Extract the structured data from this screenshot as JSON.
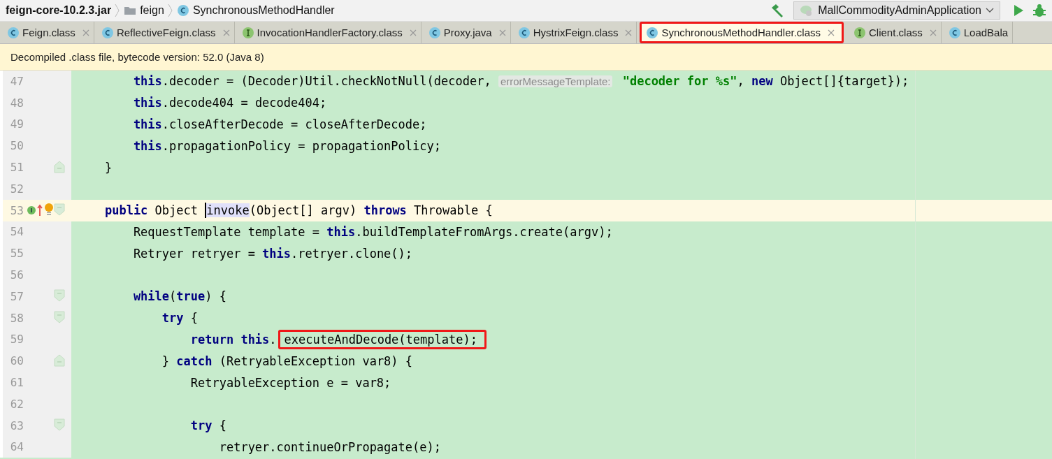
{
  "breadcrumb": [
    {
      "label": "feign-core-10.2.3.jar",
      "kind": "jar"
    },
    {
      "label": "feign",
      "kind": "folder"
    },
    {
      "label": "SynchronousMethodHandler",
      "kind": "class"
    }
  ],
  "run_config": {
    "label": "MallCommodityAdminApplication"
  },
  "tabs": [
    {
      "label": "Feign.class",
      "kind": "class",
      "selected": false,
      "closable": true,
      "marked": false
    },
    {
      "label": "ReflectiveFeign.class",
      "kind": "class",
      "selected": false,
      "closable": true,
      "marked": false
    },
    {
      "label": "InvocationHandlerFactory.class",
      "kind": "interface",
      "selected": false,
      "closable": true,
      "marked": false
    },
    {
      "label": "Proxy.java",
      "kind": "class",
      "selected": false,
      "closable": true,
      "marked": false
    },
    {
      "label": "HystrixFeign.class",
      "kind": "class",
      "selected": false,
      "closable": true,
      "marked": false
    },
    {
      "label": "SynchronousMethodHandler.class",
      "kind": "class",
      "selected": true,
      "closable": true,
      "marked": true
    },
    {
      "label": "Client.class",
      "kind": "interface",
      "selected": false,
      "closable": true,
      "marked": false
    },
    {
      "label": "LoadBala",
      "kind": "class",
      "selected": false,
      "closable": false,
      "marked": false
    }
  ],
  "banner": {
    "text": "Decompiled .class file, bytecode version: 52.0 (Java 8)"
  },
  "code_lines": [
    {
      "number": "47",
      "current": false,
      "fold_start": false,
      "fold_end": false,
      "gutter_icons": false,
      "segments": [
        {
          "kind": "kw",
          "text": "        this"
        },
        {
          "kind": "plain",
          "text": ".decoder = (Decoder)Util.checkNotNull(decoder, "
        },
        {
          "kind": "hint",
          "text": "errorMessageTemplate:"
        },
        {
          "kind": "str",
          "text": " \"decoder for %s\""
        },
        {
          "kind": "plain",
          "text": ", "
        },
        {
          "kind": "kw",
          "text": "new"
        },
        {
          "kind": "plain",
          "text": " Object[]{target});"
        }
      ]
    },
    {
      "number": "48",
      "current": false,
      "fold_start": false,
      "fold_end": false,
      "gutter_icons": false,
      "segments": [
        {
          "kind": "kw",
          "text": "        this"
        },
        {
          "kind": "plain",
          "text": ".decode404 = decode404;"
        }
      ]
    },
    {
      "number": "49",
      "current": false,
      "fold_start": false,
      "fold_end": false,
      "gutter_icons": false,
      "segments": [
        {
          "kind": "kw",
          "text": "        this"
        },
        {
          "kind": "plain",
          "text": ".closeAfterDecode = closeAfterDecode;"
        }
      ]
    },
    {
      "number": "50",
      "current": false,
      "fold_start": false,
      "fold_end": false,
      "gutter_icons": false,
      "segments": [
        {
          "kind": "kw",
          "text": "        this"
        },
        {
          "kind": "plain",
          "text": ".propagationPolicy = propagationPolicy;"
        }
      ]
    },
    {
      "number": "51",
      "current": false,
      "fold_start": false,
      "fold_end": true,
      "gutter_icons": false,
      "segments": [
        {
          "kind": "plain",
          "text": "    }"
        }
      ]
    },
    {
      "number": "52",
      "current": false,
      "fold_start": false,
      "fold_end": false,
      "gutter_icons": false
    },
    {
      "number": "53",
      "current": true,
      "fold_start": true,
      "fold_end": false,
      "gutter_icons": true,
      "segments": [
        {
          "kind": "kw",
          "text": "    public"
        },
        {
          "kind": "plain",
          "text": " Object "
        },
        {
          "kind": "ident",
          "text": "invoke"
        },
        {
          "kind": "plain",
          "text": "(Object[] argv) "
        },
        {
          "kind": "kw",
          "text": "throws"
        },
        {
          "kind": "plain",
          "text": " Throwable {"
        }
      ]
    },
    {
      "number": "54",
      "current": false,
      "fold_start": false,
      "fold_end": false,
      "gutter_icons": false,
      "segments": [
        {
          "kind": "plain",
          "text": "        RequestTemplate template = "
        },
        {
          "kind": "kw",
          "text": "this"
        },
        {
          "kind": "plain",
          "text": ".buildTemplateFromArgs.create(argv);"
        }
      ]
    },
    {
      "number": "55",
      "current": false,
      "fold_start": false,
      "fold_end": false,
      "gutter_icons": false,
      "segments": [
        {
          "kind": "plain",
          "text": "        Retryer retryer = "
        },
        {
          "kind": "kw",
          "text": "this"
        },
        {
          "kind": "plain",
          "text": ".retryer.clone();"
        }
      ]
    },
    {
      "number": "56",
      "current": false,
      "fold_start": false,
      "fold_end": false,
      "gutter_icons": false
    },
    {
      "number": "57",
      "current": false,
      "fold_start": true,
      "fold_end": false,
      "gutter_icons": false,
      "segments": [
        {
          "kind": "kw",
          "text": "        while"
        },
        {
          "kind": "plain",
          "text": "("
        },
        {
          "kind": "kw",
          "text": "true"
        },
        {
          "kind": "plain",
          "text": ") {"
        }
      ]
    },
    {
      "number": "58",
      "current": false,
      "fold_start": true,
      "fold_end": false,
      "gutter_icons": false,
      "segments": [
        {
          "kind": "kw",
          "text": "            try"
        },
        {
          "kind": "plain",
          "text": " {"
        }
      ]
    },
    {
      "number": "59",
      "current": false,
      "fold_start": false,
      "fold_end": false,
      "gutter_icons": false,
      "segments": [
        {
          "kind": "kw",
          "text": "                return this"
        },
        {
          "kind": "plain",
          "text": "."
        },
        {
          "kind": "marked",
          "text": "executeAndDecode(template);"
        }
      ]
    },
    {
      "number": "60",
      "current": false,
      "fold_start": false,
      "fold_end": true,
      "gutter_icons": false,
      "segments": [
        {
          "kind": "plain",
          "text": "            } "
        },
        {
          "kind": "kw",
          "text": "catch"
        },
        {
          "kind": "plain",
          "text": " (RetryableException var8) {"
        }
      ]
    },
    {
      "number": "61",
      "current": false,
      "fold_start": false,
      "fold_end": false,
      "gutter_icons": false,
      "segments": [
        {
          "kind": "plain",
          "text": "                RetryableException e = var8;"
        }
      ]
    },
    {
      "number": "62",
      "current": false,
      "fold_start": false,
      "fold_end": false,
      "gutter_icons": false
    },
    {
      "number": "63",
      "current": false,
      "fold_start": true,
      "fold_end": false,
      "gutter_icons": false,
      "segments": [
        {
          "kind": "kw",
          "text": "                try"
        },
        {
          "kind": "plain",
          "text": " {"
        }
      ]
    },
    {
      "number": "64",
      "current": false,
      "fold_start": false,
      "fold_end": false,
      "gutter_icons": false,
      "segments": [
        {
          "kind": "plain",
          "text": "                    retryer.continueOrPropagate(e);"
        }
      ]
    }
  ]
}
